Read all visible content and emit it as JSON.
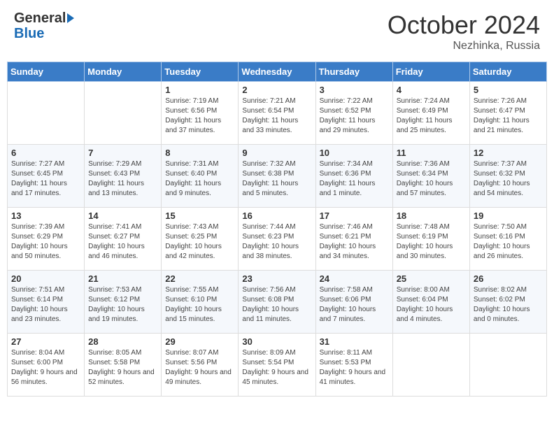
{
  "logo": {
    "general": "General",
    "blue": "Blue"
  },
  "title": "October 2024",
  "subtitle": "Nezhinka, Russia",
  "days_of_week": [
    "Sunday",
    "Monday",
    "Tuesday",
    "Wednesday",
    "Thursday",
    "Friday",
    "Saturday"
  ],
  "weeks": [
    [
      {
        "day": "",
        "info": ""
      },
      {
        "day": "",
        "info": ""
      },
      {
        "day": "1",
        "info": "Sunrise: 7:19 AM\nSunset: 6:56 PM\nDaylight: 11 hours and 37 minutes."
      },
      {
        "day": "2",
        "info": "Sunrise: 7:21 AM\nSunset: 6:54 PM\nDaylight: 11 hours and 33 minutes."
      },
      {
        "day": "3",
        "info": "Sunrise: 7:22 AM\nSunset: 6:52 PM\nDaylight: 11 hours and 29 minutes."
      },
      {
        "day": "4",
        "info": "Sunrise: 7:24 AM\nSunset: 6:49 PM\nDaylight: 11 hours and 25 minutes."
      },
      {
        "day": "5",
        "info": "Sunrise: 7:26 AM\nSunset: 6:47 PM\nDaylight: 11 hours and 21 minutes."
      }
    ],
    [
      {
        "day": "6",
        "info": "Sunrise: 7:27 AM\nSunset: 6:45 PM\nDaylight: 11 hours and 17 minutes."
      },
      {
        "day": "7",
        "info": "Sunrise: 7:29 AM\nSunset: 6:43 PM\nDaylight: 11 hours and 13 minutes."
      },
      {
        "day": "8",
        "info": "Sunrise: 7:31 AM\nSunset: 6:40 PM\nDaylight: 11 hours and 9 minutes."
      },
      {
        "day": "9",
        "info": "Sunrise: 7:32 AM\nSunset: 6:38 PM\nDaylight: 11 hours and 5 minutes."
      },
      {
        "day": "10",
        "info": "Sunrise: 7:34 AM\nSunset: 6:36 PM\nDaylight: 11 hours and 1 minute."
      },
      {
        "day": "11",
        "info": "Sunrise: 7:36 AM\nSunset: 6:34 PM\nDaylight: 10 hours and 57 minutes."
      },
      {
        "day": "12",
        "info": "Sunrise: 7:37 AM\nSunset: 6:32 PM\nDaylight: 10 hours and 54 minutes."
      }
    ],
    [
      {
        "day": "13",
        "info": "Sunrise: 7:39 AM\nSunset: 6:29 PM\nDaylight: 10 hours and 50 minutes."
      },
      {
        "day": "14",
        "info": "Sunrise: 7:41 AM\nSunset: 6:27 PM\nDaylight: 10 hours and 46 minutes."
      },
      {
        "day": "15",
        "info": "Sunrise: 7:43 AM\nSunset: 6:25 PM\nDaylight: 10 hours and 42 minutes."
      },
      {
        "day": "16",
        "info": "Sunrise: 7:44 AM\nSunset: 6:23 PM\nDaylight: 10 hours and 38 minutes."
      },
      {
        "day": "17",
        "info": "Sunrise: 7:46 AM\nSunset: 6:21 PM\nDaylight: 10 hours and 34 minutes."
      },
      {
        "day": "18",
        "info": "Sunrise: 7:48 AM\nSunset: 6:19 PM\nDaylight: 10 hours and 30 minutes."
      },
      {
        "day": "19",
        "info": "Sunrise: 7:50 AM\nSunset: 6:16 PM\nDaylight: 10 hours and 26 minutes."
      }
    ],
    [
      {
        "day": "20",
        "info": "Sunrise: 7:51 AM\nSunset: 6:14 PM\nDaylight: 10 hours and 23 minutes."
      },
      {
        "day": "21",
        "info": "Sunrise: 7:53 AM\nSunset: 6:12 PM\nDaylight: 10 hours and 19 minutes."
      },
      {
        "day": "22",
        "info": "Sunrise: 7:55 AM\nSunset: 6:10 PM\nDaylight: 10 hours and 15 minutes."
      },
      {
        "day": "23",
        "info": "Sunrise: 7:56 AM\nSunset: 6:08 PM\nDaylight: 10 hours and 11 minutes."
      },
      {
        "day": "24",
        "info": "Sunrise: 7:58 AM\nSunset: 6:06 PM\nDaylight: 10 hours and 7 minutes."
      },
      {
        "day": "25",
        "info": "Sunrise: 8:00 AM\nSunset: 6:04 PM\nDaylight: 10 hours and 4 minutes."
      },
      {
        "day": "26",
        "info": "Sunrise: 8:02 AM\nSunset: 6:02 PM\nDaylight: 10 hours and 0 minutes."
      }
    ],
    [
      {
        "day": "27",
        "info": "Sunrise: 8:04 AM\nSunset: 6:00 PM\nDaylight: 9 hours and 56 minutes."
      },
      {
        "day": "28",
        "info": "Sunrise: 8:05 AM\nSunset: 5:58 PM\nDaylight: 9 hours and 52 minutes."
      },
      {
        "day": "29",
        "info": "Sunrise: 8:07 AM\nSunset: 5:56 PM\nDaylight: 9 hours and 49 minutes."
      },
      {
        "day": "30",
        "info": "Sunrise: 8:09 AM\nSunset: 5:54 PM\nDaylight: 9 hours and 45 minutes."
      },
      {
        "day": "31",
        "info": "Sunrise: 8:11 AM\nSunset: 5:53 PM\nDaylight: 9 hours and 41 minutes."
      },
      {
        "day": "",
        "info": ""
      },
      {
        "day": "",
        "info": ""
      }
    ]
  ]
}
